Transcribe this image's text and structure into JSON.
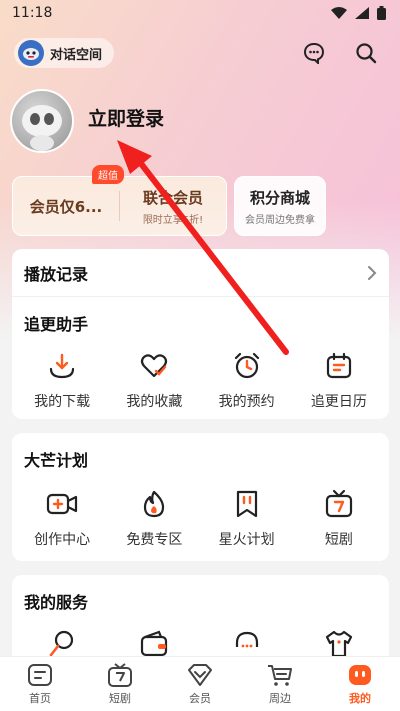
{
  "status": {
    "time": "11:18"
  },
  "header": {
    "space_label": "对话空间"
  },
  "profile": {
    "login_text": "立即登录"
  },
  "vip": {
    "badge": "超值",
    "member_title": "会员仅6...",
    "member_sub": "",
    "union_title": "联合会员",
    "union_sub": "限时立享5折!",
    "shop_title": "积分商城",
    "shop_sub": "会员周边免费拿"
  },
  "history": {
    "label": "播放记录"
  },
  "assistant": {
    "title": "追更助手",
    "items": [
      {
        "label": "我的下载",
        "icon": "download-icon"
      },
      {
        "label": "我的收藏",
        "icon": "heart-icon"
      },
      {
        "label": "我的预约",
        "icon": "alarm-clock-icon"
      },
      {
        "label": "追更日历",
        "icon": "calendar-icon"
      }
    ]
  },
  "mango_plan": {
    "title": "大芒计划",
    "items": [
      {
        "label": "创作中心",
        "icon": "video-camera-icon"
      },
      {
        "label": "免费专区",
        "icon": "flame-icon"
      },
      {
        "label": "星火计划",
        "icon": "bookmark-icon"
      },
      {
        "label": "短剧",
        "icon": "tv-icon"
      }
    ]
  },
  "services": {
    "title": "我的服务"
  },
  "tabs": [
    {
      "label": "首页",
      "icon": "home-icon"
    },
    {
      "label": "短剧",
      "icon": "short-drama-icon"
    },
    {
      "label": "会员",
      "icon": "diamond-icon"
    },
    {
      "label": "周边",
      "icon": "cart-icon"
    },
    {
      "label": "我的",
      "icon": "profile-icon",
      "active": true
    }
  ],
  "colors": {
    "accent": "#ff5a1f",
    "annotation_arrow": "#f0201e"
  }
}
